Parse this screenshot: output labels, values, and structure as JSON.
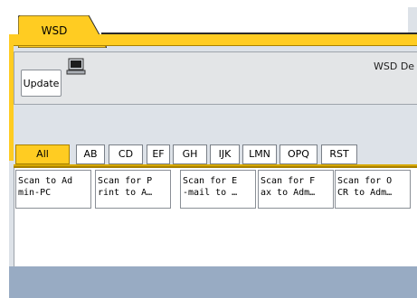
{
  "tab": {
    "label": "WSD"
  },
  "header": {
    "update_label": "Update",
    "description": "WSD De"
  },
  "filters": [
    {
      "label": "All",
      "selected": true
    },
    {
      "label": "AB",
      "selected": false
    },
    {
      "label": "CD",
      "selected": false
    },
    {
      "label": "EF",
      "selected": false
    },
    {
      "label": "GH",
      "selected": false
    },
    {
      "label": "IJK",
      "selected": false
    },
    {
      "label": "LMN",
      "selected": false
    },
    {
      "label": "OPQ",
      "selected": false
    },
    {
      "label": "RST",
      "selected": false
    }
  ],
  "destinations": [
    {
      "line1": "Scan to Ad",
      "line2": "min-PC"
    },
    {
      "line1": "Scan for P",
      "line2": "rint to A…"
    },
    {
      "line1": "Scan for E",
      "line2": "-mail to …"
    },
    {
      "line1": "Scan for F",
      "line2": "ax to Adm…"
    },
    {
      "line1": "Scan for O",
      "line2": "CR to Adm…"
    }
  ],
  "icons": {
    "monitor": "computer-monitor-icon"
  },
  "colors": {
    "accent": "#ffcc22",
    "background": "#dde2e8",
    "footer": "#98abc3"
  }
}
